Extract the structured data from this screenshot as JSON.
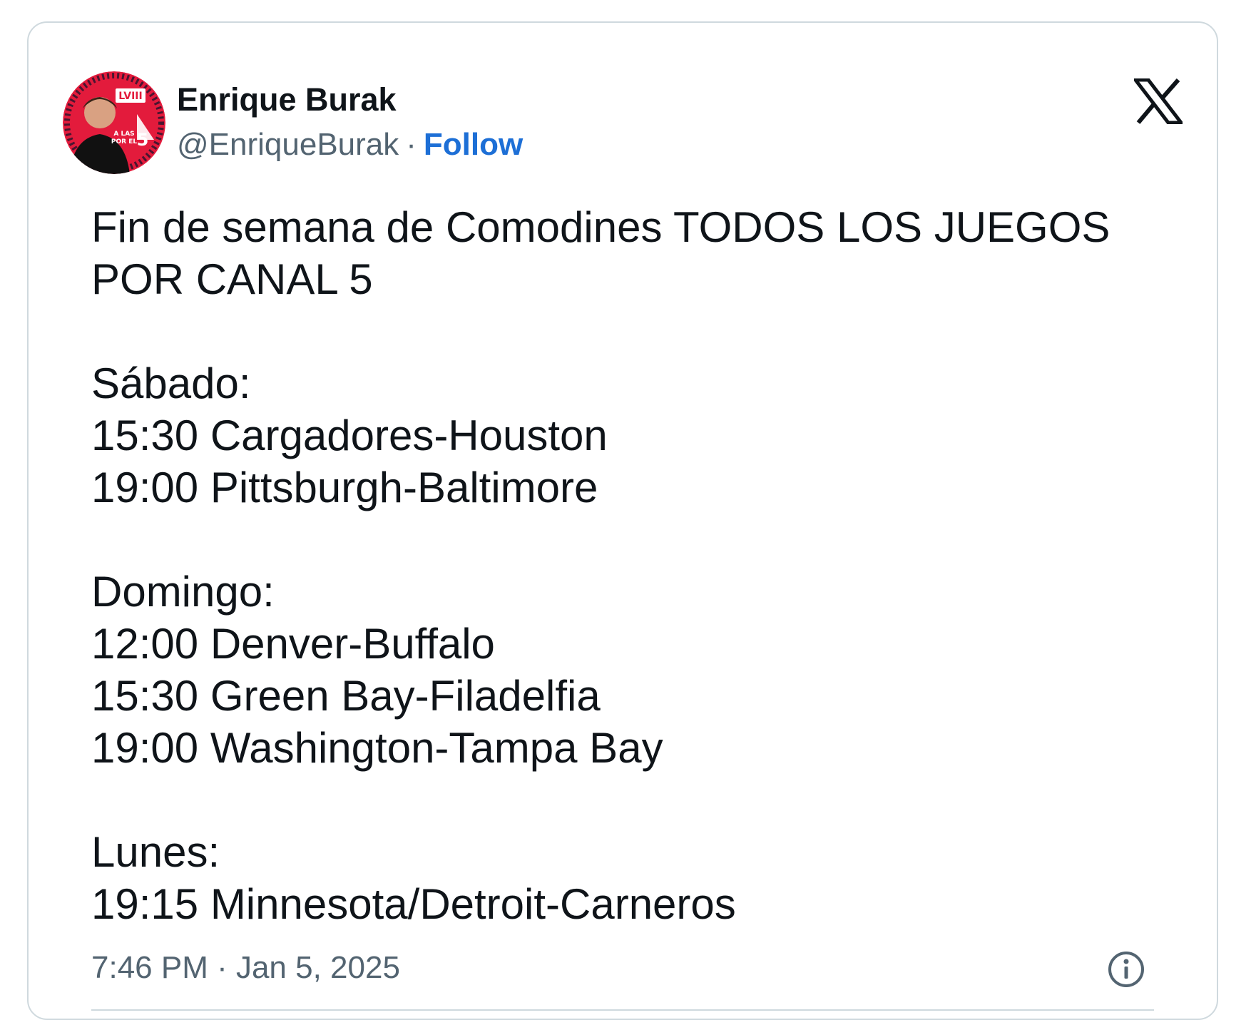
{
  "author": {
    "name": "Enrique Burak",
    "handle": "@EnriqueBurak",
    "separator": "·",
    "follow_label": "Follow",
    "avatar_icon": "profile-avatar",
    "avatar_logo_text": "LVIII",
    "avatar_badge_top": "A LAS",
    "avatar_badge_bottom": "POR EL",
    "avatar_badge_number": "5"
  },
  "tweet": {
    "text": "Fin de semana de Comodines TODOS LOS JUEGOS POR CANAL 5\n\nSábado:\n15:30 Cargadores-Houston\n19:00 Pittsburgh-Baltimore\n\nDomingo:\n12:00 Denver-Buffalo\n15:30 Green Bay-Filadelfia\n19:00 Washington-Tampa Bay\n\nLunes:\n19:15 Minnesota/Detroit-Carneros",
    "timestamp": "7:46 PM · Jan 5, 2025"
  },
  "icons": {
    "brand": "x-logo-icon",
    "info": "info-icon"
  },
  "colors": {
    "follow": "#1d6fd6",
    "secondary_text": "#536471",
    "border": "#cfd9de",
    "avatar_red": "#e31b3c"
  }
}
